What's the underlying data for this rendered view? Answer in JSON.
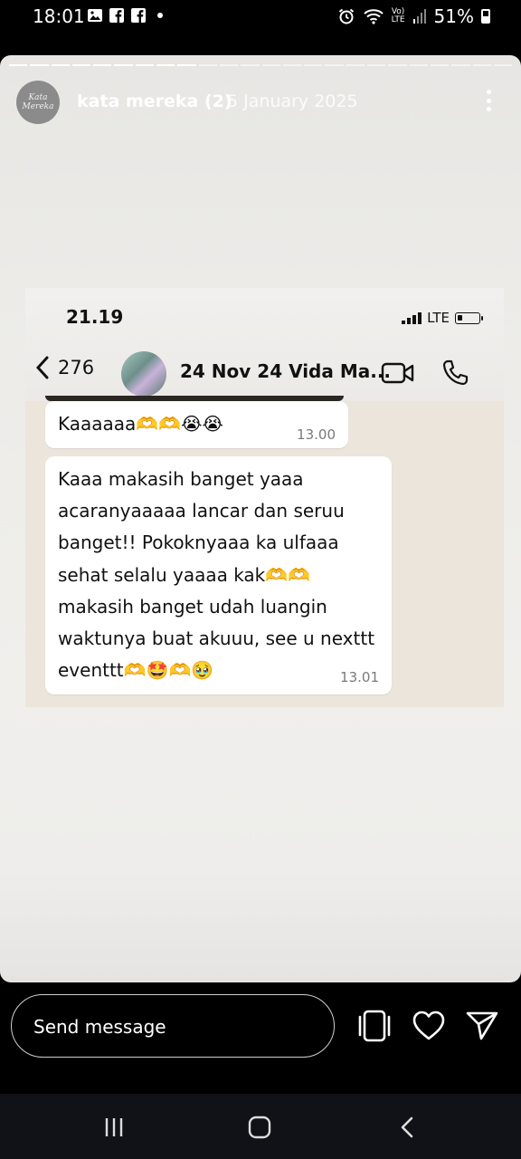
{
  "status_bar": {
    "time": "18:01",
    "battery": "51%",
    "network": "LTE"
  },
  "story": {
    "username": "kata mereka (2)",
    "date": "5 January 2025",
    "avatar_text": "Kata Mereka",
    "progress_total": 24,
    "progress_done": 9
  },
  "chat_screenshot": {
    "time": "21.19",
    "network": "LTE",
    "back_count": "276",
    "chat_name": "24 Nov 24 Vida Ma...",
    "messages": [
      {
        "text": "Kaaaaaa🫶🫶😭😭",
        "time": "13.00"
      },
      {
        "text": "Kaaa makasih banget yaaa acaranyaaaaa lancar dan seruu banget!! Pokoknyaaa ka ulfaaa sehat selalu yaaaa kak🫶🫶 makasih banget udah luangin waktunya buat akuuu, see u nexttt eventtt🫶🤩🫶🥹",
        "time": "13.01"
      }
    ]
  },
  "composer": {
    "placeholder": "Send message"
  },
  "icons": {
    "share": "share-icon",
    "like": "heart-icon",
    "send": "send-icon"
  }
}
